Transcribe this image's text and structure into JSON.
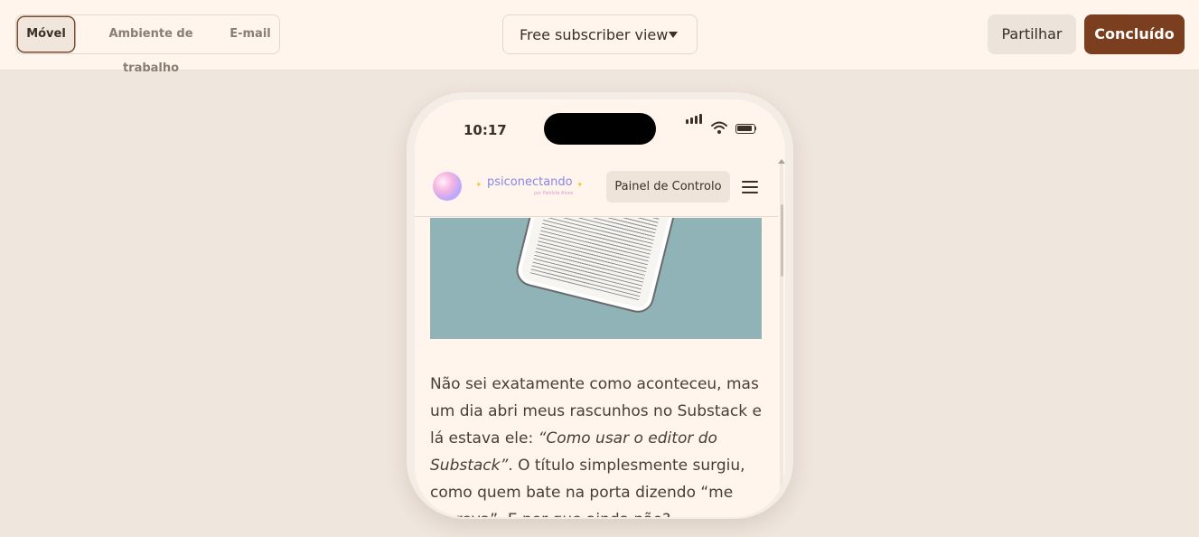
{
  "toolbar": {
    "tabs": [
      {
        "label": "Móvel",
        "active": true
      },
      {
        "label": "Ambiente de trabalho",
        "active": false
      },
      {
        "label": "E-mail",
        "active": false
      }
    ],
    "view_select": {
      "label": "Free subscriber view"
    },
    "share_label": "Partilhar",
    "done_label": "Concluído"
  },
  "phone": {
    "status": {
      "time": "10:17"
    },
    "nav": {
      "brand": "psiconectando",
      "brand_sub": "por Patrícia Alves",
      "dashboard_label": "Painel de Controlo"
    },
    "post": {
      "p1": "Não sei exatamente como aconteceu, mas um dia abri meus rascunhos no Substack e lá estava ele: ",
      "p2": "“Como usar o editor do Substack”",
      "p3": ". O título simplesmente surgiu, como quem bate na porta dizendo “me escreva”. E por que ainda não? ..."
    }
  },
  "colors": {
    "accent": "#7b3f20",
    "topbar_bg": "#fff5ed",
    "canvas_bg": "#efe6dd",
    "hero_bg": "#8fb3b7",
    "brand": "#8a86e6"
  }
}
